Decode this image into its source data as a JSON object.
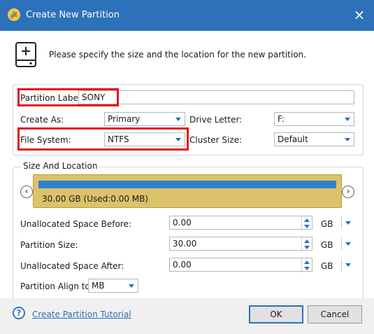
{
  "window": {
    "title": "Create New Partition",
    "close_glyph": "×"
  },
  "header": {
    "text": "Please specify the size and the location for the new partition.",
    "icon": "disk-add-icon"
  },
  "form": {
    "partition_label": {
      "label": "Partition Label:",
      "value": "SONY"
    },
    "create_as": {
      "label": "Create As:",
      "value": "Primary"
    },
    "drive_letter": {
      "label": "Drive Letter:",
      "value": "F:"
    },
    "file_system": {
      "label": "File System:",
      "value": "NTFS"
    },
    "cluster_size": {
      "label": "Cluster Size:",
      "value": "Default"
    }
  },
  "size_location": {
    "title": "Size And Location",
    "bar_text": "30.00 GB (Used:0.00 MB)",
    "bar_used_fraction": 0.0,
    "rows": [
      {
        "label": "Unallocated Space Before:",
        "value": "0.00",
        "unit": "GB"
      },
      {
        "label": "Partition Size:",
        "value": "30.00",
        "unit": "GB"
      },
      {
        "label": "Unallocated Space After:",
        "value": "0.00",
        "unit": "GB"
      }
    ],
    "align": {
      "label": "Partition Align to:",
      "value": "MB"
    }
  },
  "footer": {
    "help_glyph": "?",
    "tutorial_link": "Create Partition Tutorial",
    "ok": "OK",
    "cancel": "Cancel"
  },
  "nav": {
    "left": "‹",
    "right": "›"
  },
  "colors": {
    "titlebar": "#2c71b9",
    "highlight": "#e3101c",
    "bar": "#dcc36b",
    "bar_fill": "#2f82ce"
  }
}
